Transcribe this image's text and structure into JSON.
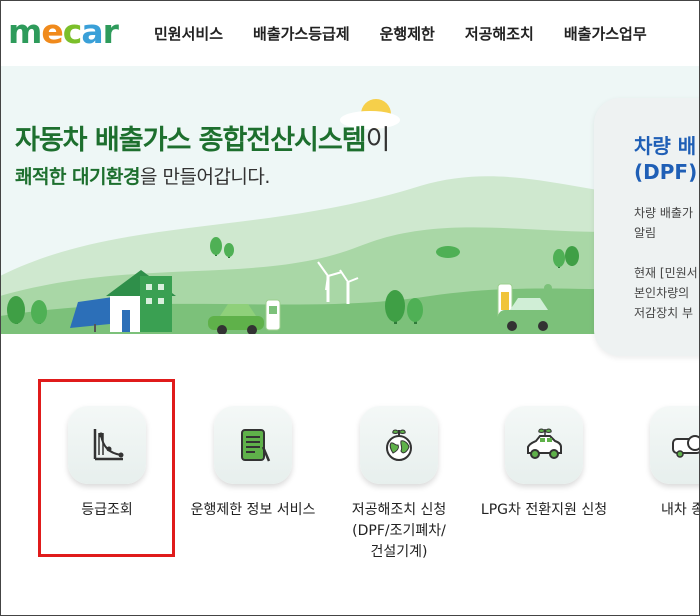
{
  "header": {
    "logo_letters": [
      "m",
      "e",
      "c",
      "a",
      "r"
    ],
    "logo_colors": [
      "#2e9b5b",
      "#f08a1c",
      "#7bbf2a",
      "#3aa0d8",
      "#2e9b5b"
    ],
    "nav": [
      "민원서비스",
      "배출가스등급제",
      "운행제한",
      "저공해조치",
      "배출가스업무"
    ]
  },
  "hero": {
    "title_main": "자동차 배출가스 종합전산시스템",
    "title_tail": "이",
    "sub_bold": "쾌적한 대기환경",
    "sub_rest": "을 만들어갑니다."
  },
  "side_card": {
    "title_line1": "차량 배",
    "title_line2": "(DPF) ·",
    "lines": [
      "차량 배출가",
      "알림",
      "현재 [민원서",
      "본인차량의",
      "저감장치 부"
    ]
  },
  "services": [
    {
      "label": "등급조회",
      "icon": "grade-chart-icon"
    },
    {
      "label": "운행제한 정보 서비스",
      "icon": "tablet-pen-icon"
    },
    {
      "label": "저공해조치 신청\n(DPF/조기폐차/\n건설기계)",
      "icon": "earth-sprout-icon"
    },
    {
      "label": "LPG차 전환지원 신청",
      "icon": "eco-car-icon"
    },
    {
      "label": "내차 종합",
      "icon": "car-search-icon"
    }
  ],
  "colors": {
    "brand_green": "#1d6f2e",
    "side_blue": "#1f5fb6",
    "highlight_red": "#e01b1b"
  }
}
